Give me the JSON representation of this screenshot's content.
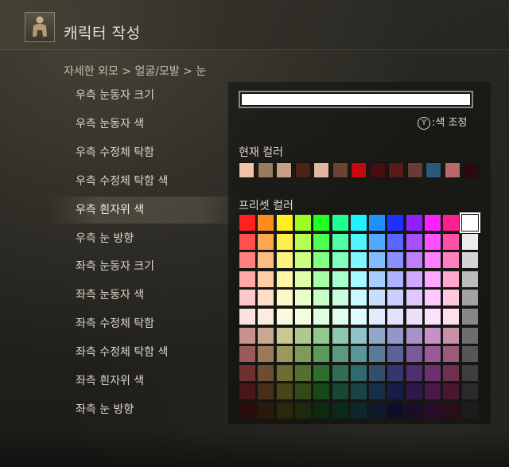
{
  "header": {
    "title": "캐릭터 작성",
    "icon": "character-silhouette-icon"
  },
  "breadcrumb": "자세한 외모 > 얼굴/모발 > 눈",
  "menu": {
    "selected_index": 4,
    "items": [
      "우측 눈동자 크기",
      "우측 눈동자 색",
      "우측 수정체 탁함",
      "우측 수정체 탁함 색",
      "우측 흰자위 색",
      "우측 눈 방향",
      "좌측 눈동자 크기",
      "좌측 눈동자 색",
      "좌측 수정체 탁함",
      "좌측 수정체 탁함 색",
      "좌측 흰자위 색",
      "좌측 눈 방향"
    ]
  },
  "color_input": {
    "value": ""
  },
  "color_adjust": {
    "button": "Y",
    "label": ":색 조정"
  },
  "current_colors": {
    "label": "현재 컬러",
    "swatches": [
      "#f2c4a4",
      "#9a7a60",
      "#c8a088",
      "#4a2418",
      "#e0b8a0",
      "#6a4430",
      "#c80810",
      "#4a0e10",
      "#5a1a1a",
      "#6a3a34",
      "#2e5878",
      "#b86a6a",
      "#2a0a0a"
    ]
  },
  "preset_colors": {
    "label": "프리셋 컬러",
    "selected_row": 0,
    "selected_col": 12,
    "rows": [
      [
        "#ff2020",
        "#ff8a20",
        "#ffee20",
        "#9aff20",
        "#20ff20",
        "#20ff90",
        "#20f0ff",
        "#2090ff",
        "#2030ff",
        "#9020ff",
        "#ff20ff",
        "#ff2090",
        "#ffffff"
      ],
      [
        "#ff5050",
        "#ffa650",
        "#fff050",
        "#b6ff50",
        "#50ff50",
        "#50ffa8",
        "#50f4ff",
        "#50a8ff",
        "#5a66ff",
        "#a850ff",
        "#ff50ff",
        "#ff50a8",
        "#ececec"
      ],
      [
        "#ff8080",
        "#ffbc80",
        "#fff380",
        "#cbff80",
        "#80ff80",
        "#80ffbe",
        "#80f6ff",
        "#80bcff",
        "#8a90ff",
        "#bc80ff",
        "#ff80ff",
        "#ff80bc",
        "#d4d4d4"
      ],
      [
        "#ffa8a8",
        "#ffcea8",
        "#fff6a8",
        "#dcffa8",
        "#a8ffa8",
        "#a8ffd0",
        "#a8f8ff",
        "#a8ceff",
        "#aeb2ff",
        "#cea8ff",
        "#ffa8ff",
        "#ffa8ce",
        "#bcbcbc"
      ],
      [
        "#ffc8c8",
        "#ffdec8",
        "#fff8c8",
        "#eaffc8",
        "#c8ffc8",
        "#c8ffe0",
        "#c8faff",
        "#c8deff",
        "#cccfff",
        "#dec8ff",
        "#ffc8ff",
        "#ffc8de",
        "#a2a2a2"
      ],
      [
        "#fde0e0",
        "#fcece0",
        "#fbfae0",
        "#f2fde0",
        "#e0fde0",
        "#e0fdee",
        "#e0fcfd",
        "#e0ecfd",
        "#e2e4fd",
        "#ece0fd",
        "#fde0fd",
        "#fde0ec",
        "#888888"
      ],
      [
        "#c89090",
        "#c8a890",
        "#c8c890",
        "#aec890",
        "#90c890",
        "#90c8ac",
        "#90c4c8",
        "#90a8c8",
        "#9496c8",
        "#a890c8",
        "#c890c8",
        "#c890a8",
        "#6e6e6e"
      ],
      [
        "#9a5a5a",
        "#9a7a5a",
        "#9a985a",
        "#809a5a",
        "#5a9a5a",
        "#5a9a7e",
        "#5a969a",
        "#5a7a9a",
        "#5e609a",
        "#7a5a9a",
        "#9a5a9a",
        "#9a5a7a",
        "#565656"
      ],
      [
        "#6e3030",
        "#6e4e30",
        "#6e6c30",
        "#566e30",
        "#306e30",
        "#306e52",
        "#306a6e",
        "#304e6e",
        "#34366e",
        "#4e306e",
        "#6e306e",
        "#6e304e",
        "#3e3e3e"
      ],
      [
        "#481818",
        "#482e18",
        "#484618",
        "#344818",
        "#184818",
        "#184832",
        "#184448",
        "#182e48",
        "#1a1c48",
        "#2e1848",
        "#481848",
        "#48182e",
        "#2a2a2a"
      ],
      [
        "#2a0c0c",
        "#2a1a0c",
        "#2a280c",
        "#1e2a0c",
        "#0c2a0c",
        "#0c2a1c",
        "#0c282a",
        "#0c1a2a",
        "#0e0e2a",
        "#1a0c2a",
        "#2a0c2a",
        "#2a0c1a",
        "#1c1c1c"
      ]
    ]
  },
  "colors": {
    "accent_text": "#d9d5c7",
    "selection_outline": "#ffffff"
  }
}
